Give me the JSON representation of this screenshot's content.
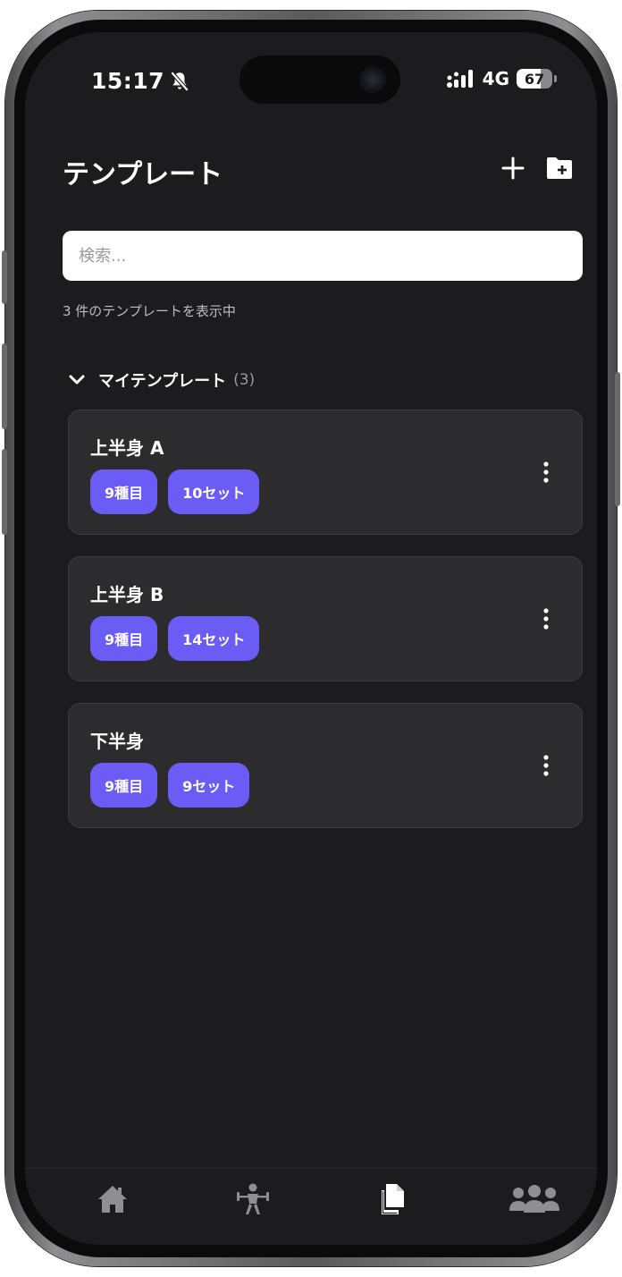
{
  "status_bar": {
    "time": "15:17",
    "network": "4G",
    "battery": "67"
  },
  "header": {
    "title": "テンプレート"
  },
  "search": {
    "placeholder": "検索..."
  },
  "summary": {
    "count_text": "3 件のテンプレートを表示中"
  },
  "section": {
    "title": "マイテンプレート",
    "count": "(3)"
  },
  "templates": [
    {
      "name": "上半身 A",
      "exercises": "9種目",
      "sets": "10セット"
    },
    {
      "name": "上半身 B",
      "exercises": "9種目",
      "sets": "14セット"
    },
    {
      "name": "下半身",
      "exercises": "9種目",
      "sets": "9セット"
    }
  ],
  "tabs": [
    {
      "icon": "home-icon",
      "active": false
    },
    {
      "icon": "weightlifting-icon",
      "active": false
    },
    {
      "icon": "documents-icon",
      "active": true
    },
    {
      "icon": "users-icon",
      "active": false
    }
  ],
  "colors": {
    "background": "#1c1c1e",
    "card": "#2c2c2e",
    "accent": "#6a5cf5",
    "inactive_icon": "#8e8e93"
  }
}
